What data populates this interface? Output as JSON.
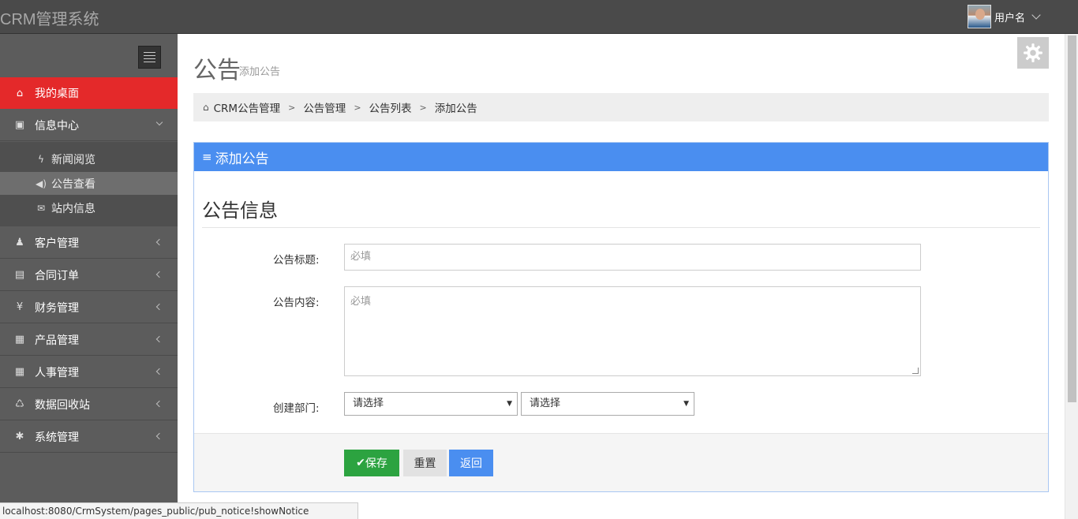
{
  "app": {
    "brand": "CRM管理系统",
    "username": "用户名"
  },
  "sidebar": {
    "items": [
      {
        "label": "我的桌面",
        "icon": "home-icon",
        "glyph": "⌂"
      },
      {
        "label": "信息中心",
        "icon": "info-center-icon",
        "glyph": "▣"
      },
      {
        "label": "客户管理",
        "icon": "person-icon",
        "glyph": "♟"
      },
      {
        "label": "合同订单",
        "icon": "book-icon",
        "glyph": "▤"
      },
      {
        "label": "财务管理",
        "icon": "yen-icon",
        "glyph": "¥"
      },
      {
        "label": "产品管理",
        "icon": "table-icon",
        "glyph": "▦"
      },
      {
        "label": "人事管理",
        "icon": "table-icon",
        "glyph": "▦"
      },
      {
        "label": "数据回收站",
        "icon": "trash-icon",
        "glyph": "♺"
      },
      {
        "label": "系统管理",
        "icon": "gear-icon",
        "glyph": "✱"
      }
    ],
    "subitems": [
      {
        "label": "新闻阅览",
        "icon": "bolt-icon",
        "glyph": "ϟ"
      },
      {
        "label": "公告查看",
        "icon": "volume-icon",
        "glyph": "◀)"
      },
      {
        "label": "站内信息",
        "icon": "envelope-icon",
        "glyph": "✉"
      }
    ]
  },
  "page": {
    "title": "公告",
    "subtitle": "添加公告"
  },
  "breadcrumb": [
    "CRM公告管理",
    "公告管理",
    "公告列表",
    "添加公告"
  ],
  "panel": {
    "header": "添加公告",
    "section_title": "公告信息",
    "title_label": "公告标题:",
    "title_placeholder": "必填",
    "content_label": "公告内容:",
    "content_placeholder": "必填",
    "dept_label": "创建部门:",
    "select1": "请选择",
    "select2": "请选择",
    "save": "保存",
    "reset": "重置",
    "back": "返回"
  },
  "status_url": "localhost:8080/CrmSystem/pages_public/pub_notice!showNotice",
  "colors": {
    "active_nav": "#e4292a",
    "primary": "#4a8ef0",
    "success": "#2ca340",
    "sidebar": "#5c5c5c",
    "topbar": "#4a4a4a"
  }
}
